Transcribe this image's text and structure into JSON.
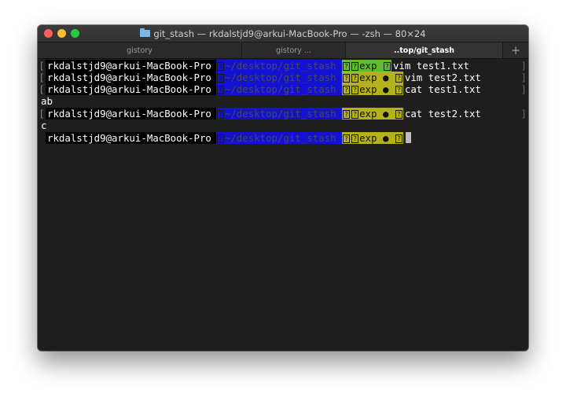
{
  "window": {
    "title": "git_stash — rkdalstjd9@arkui-MacBook-Pro — -zsh — 80×24"
  },
  "tabs": [
    {
      "label": "gistory"
    },
    {
      "label": "gistory ..."
    },
    {
      "label": "..top/git_stash"
    }
  ],
  "new_tab_label": "+",
  "prompt": {
    "host": "rkdalstjd9@arkui-MacBook-Pro",
    "path": "~/desktop/git_stash",
    "branch": "exp",
    "dirty_marker": "●",
    "glyph": "?"
  },
  "lines": [
    {
      "cmd": "vim test1.txt"
    },
    {
      "cmd": "vim test2.txt"
    },
    {
      "cmd": "cat test1.txt"
    },
    {
      "output": "ab"
    },
    {
      "cmd": "cat test2.txt"
    },
    {
      "output": "c"
    }
  ],
  "colors": {
    "path_bg": "#1212d0",
    "git_clean_bg": "#5fbd30",
    "git_dirty_bg": "#b4b01e",
    "host_bg": "#000000"
  }
}
